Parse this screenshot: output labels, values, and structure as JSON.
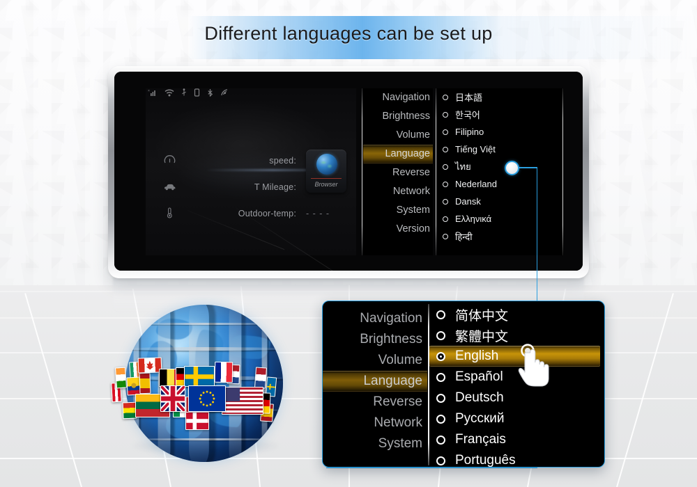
{
  "page": {
    "title": "Different languages can be set up",
    "accent_blue": "#2b9fe0",
    "highlight_gold": "#c79309"
  },
  "device_screen": {
    "status_icons": [
      "signal-icon",
      "wifi-icon",
      "usb-icon",
      "sim-card-icon",
      "bluetooth-icon",
      "cast-icon"
    ],
    "dashboard": {
      "rows": [
        {
          "icon": "speedometer-icon",
          "label": "speed:",
          "value": "- - - -"
        },
        {
          "icon": "car-icon",
          "label": "T Mileage:",
          "value": "- - - -"
        },
        {
          "icon": "thermometer-icon",
          "label": "Outdoor-temp:",
          "value": "- - - -"
        }
      ]
    },
    "app_tile": {
      "name": "Browser",
      "icon": "globe-icon"
    },
    "settings_menu": {
      "items": [
        {
          "label": "Navigation",
          "selected": false
        },
        {
          "label": "Brightness",
          "selected": false
        },
        {
          "label": "Volume",
          "selected": false
        },
        {
          "label": "Language",
          "selected": true
        },
        {
          "label": "Reverse",
          "selected": false
        },
        {
          "label": "Network",
          "selected": false
        },
        {
          "label": "System",
          "selected": false
        },
        {
          "label": "Version",
          "selected": false
        }
      ]
    },
    "language_list": {
      "items": [
        {
          "label": "日本語",
          "selected": false
        },
        {
          "label": "한국어",
          "selected": false
        },
        {
          "label": "Filipino",
          "selected": false
        },
        {
          "label": "Tiếng Việt",
          "selected": false
        },
        {
          "label": "ไทย",
          "selected": false
        },
        {
          "label": "Nederland",
          "selected": false
        },
        {
          "label": "Dansk",
          "selected": false
        },
        {
          "label": "Ελληνικά",
          "selected": false
        },
        {
          "label": "हिन्दी",
          "selected": false
        }
      ]
    }
  },
  "zoom_panel": {
    "settings_menu": {
      "items": [
        {
          "label": "Navigation",
          "selected": false
        },
        {
          "label": "Brightness",
          "selected": false
        },
        {
          "label": "Volume",
          "selected": false
        },
        {
          "label": "Language",
          "selected": true
        },
        {
          "label": "Reverse",
          "selected": false
        },
        {
          "label": "Network",
          "selected": false
        },
        {
          "label": "System",
          "selected": false
        }
      ]
    },
    "language_list": {
      "items": [
        {
          "label": "简体中文",
          "selected": false
        },
        {
          "label": "繁體中文",
          "selected": false
        },
        {
          "label": "English",
          "selected": true
        },
        {
          "label": "Español",
          "selected": false
        },
        {
          "label": "Deutsch",
          "selected": false
        },
        {
          "label": "Русский",
          "selected": false
        },
        {
          "label": "Français",
          "selected": false
        },
        {
          "label": "Português",
          "selected": false
        }
      ]
    },
    "cursor": "pointing-hand-cursor"
  },
  "globe": {
    "icon": "globe-with-flags",
    "flags": [
      "india",
      "canada",
      "belgium",
      "germany-small",
      "sweden",
      "france",
      "netherlands",
      "usa",
      "united-kingdom",
      "european-union",
      "italy",
      "germany",
      "lithuania",
      "ecuador",
      "bolivia",
      "peru",
      "denmark",
      "spain",
      "ireland",
      "poland"
    ]
  }
}
